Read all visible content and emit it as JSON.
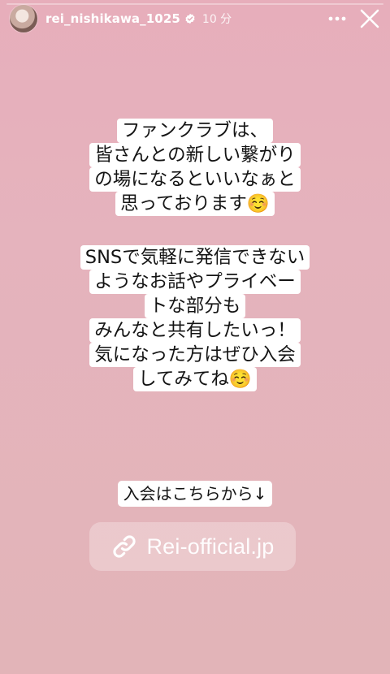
{
  "progress": {
    "fraction": 0.0
  },
  "header": {
    "username": "rei_nishikawa_1025",
    "time": "10 分",
    "more_icon": "more-horizontal-icon",
    "close_icon": "close-icon",
    "verified_icon": "verified-badge-icon"
  },
  "story": {
    "block1": [
      "ファンクラブは、",
      "皆さんとの新しい繋がり",
      "の場になるといいなぁと",
      "思っております☺️"
    ],
    "block2": [
      "SNSで気軽に発信できない",
      "ようなお話やプライベー",
      "トな部分も",
      "みんなと共有したいっ！",
      "気になった方はぜひ入会",
      "してみてね☺️"
    ],
    "cta": "入会はこちらから↓",
    "link": {
      "text": "Rei-official.jp",
      "icon": "link-icon"
    }
  },
  "colors": {
    "background_top": "#e7aebb",
    "background_bottom": "#e2b4b8",
    "text_bg": "#ffffff",
    "text": "#141414",
    "verified": "#ffffff"
  }
}
